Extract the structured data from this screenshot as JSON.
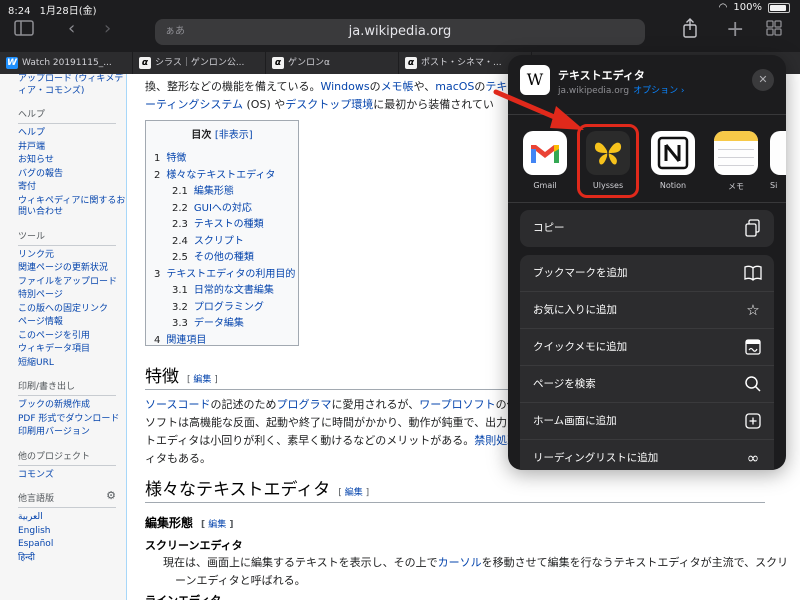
{
  "status": {
    "time": "8:24",
    "date": "1月28日(金)",
    "battery": "100%"
  },
  "toolbar": {
    "url": "ja.wikipedia.org",
    "url_prefix": "ぁあ"
  },
  "tabs": [
    {
      "label": "Watch 20191115_...",
      "icon": "W"
    },
    {
      "label": "シラス｜ゲンロン公...",
      "icon": "α"
    },
    {
      "label": "ゲンロンα",
      "icon": "α"
    },
    {
      "label": "ポスト・シネマ・...",
      "icon": "α"
    }
  ],
  "sidebar": {
    "top_item": "アップロード (ウィキメディア・コモンズ)",
    "sections": [
      {
        "heading": "ヘルプ",
        "items": [
          "ヘルプ",
          "井戸端",
          "お知らせ",
          "バグの報告",
          "寄付",
          "ウィキペディアに関するお問い合わせ"
        ]
      },
      {
        "heading": "ツール",
        "items": [
          "リンク元",
          "関連ページの更新状況",
          "ファイルをアップロード",
          "特別ページ",
          "この版への固定リンク",
          "ページ情報",
          "このページを引用",
          "ウィキデータ項目",
          "短縮URL"
        ]
      },
      {
        "heading": "印刷/書き出し",
        "items": [
          "ブックの新規作成",
          "PDF 形式でダウンロード",
          "印刷用バージョン"
        ]
      },
      {
        "heading": "他のプロジェクト",
        "items": [
          "コモンズ"
        ]
      },
      {
        "heading": "他言語版",
        "items": [
          "العربية",
          "English",
          "Español",
          "हिन्दी"
        ]
      }
    ]
  },
  "article": {
    "intro_line1_a": "換、整形などの機能を備えている。",
    "intro_line1_link1": "Windows",
    "intro_line1_b": "の",
    "intro_line1_link2": "メモ帳",
    "intro_line1_c": "や、",
    "intro_line1_link3": "macOS",
    "intro_line1_d": "の",
    "intro_line1_link4": "テキス",
    "intro_line2_link1": "ーティングシステム",
    "intro_line2_a": " (OS) や",
    "intro_line2_link2": "デスクトップ環境",
    "intro_line2_b": "に最初から装備されてい",
    "toc": {
      "title": "目次",
      "hide": "[非表示]",
      "entries": [
        {
          "n": "1",
          "label": "特徴",
          "sub": false
        },
        {
          "n": "2",
          "label": "様々なテキストエディタ",
          "sub": false
        },
        {
          "n": "2.1",
          "label": "編集形態",
          "sub": true
        },
        {
          "n": "2.2",
          "label": "GUIへの対応",
          "sub": true
        },
        {
          "n": "2.3",
          "label": "テキストの種類",
          "sub": true
        },
        {
          "n": "2.4",
          "label": "スクリプト",
          "sub": true
        },
        {
          "n": "2.5",
          "label": "その他の種類",
          "sub": true
        },
        {
          "n": "3",
          "label": "テキストエディタの利用目的",
          "sub": false
        },
        {
          "n": "3.1",
          "label": "日常的な文書編集",
          "sub": true
        },
        {
          "n": "3.2",
          "label": "プログラミング",
          "sub": true
        },
        {
          "n": "3.3",
          "label": "データ編集",
          "sub": true
        },
        {
          "n": "4",
          "label": "関連項目",
          "sub": false
        }
      ]
    },
    "h_features": "特徴",
    "edit_label": "編集",
    "features_l1_link1": "ソースコード",
    "features_l1_a": "の記述のため",
    "features_l1_link2": "プログラマ",
    "features_l1_b": "に愛用されるが、",
    "features_l1_link3": "ワープロソフト",
    "features_l1_c": "の代",
    "features_l2": "ソフトは高機能な反面、起動や終了に時間がかかり、動作が鈍重で、出力さ",
    "features_l3_a": "トエディタは小回りが利く、素早く動けるなどのメリットがある。",
    "features_l3_link": "禁則処理",
    "features_l4": "ィタもある。",
    "h_various": "様々なテキストエディタ",
    "h_edit_form": "編集形態",
    "h_screen_editor": "スクリーンエディタ",
    "screen_l1_a": "現在は、画面上に編集するテキストを表示し、その上で",
    "screen_l1_link": "カーソル",
    "screen_l1_b": "を移動させて編集を行なうテキストエディタが主流で、スクリ",
    "screen_l2": "ーンエディタと呼ばれる。",
    "h_line_editor": "ラインエディタ"
  },
  "share": {
    "title": "テキストエディタ",
    "domain": "ja.wikipedia.org",
    "options": "オプション ›",
    "close": "✕",
    "apps": [
      {
        "label": "Gmail"
      },
      {
        "label": "Ulysses"
      },
      {
        "label": "Notion"
      },
      {
        "label": "メモ"
      },
      {
        "label": "Si"
      }
    ],
    "copy": "コピー",
    "actions": [
      {
        "label": "ブックマークを追加",
        "icon": "book-icon"
      },
      {
        "label": "お気に入りに追加",
        "icon": "star-icon"
      },
      {
        "label": "クイックメモに追加",
        "icon": "quick-note-icon"
      },
      {
        "label": "ページを検索",
        "icon": "search-icon"
      },
      {
        "label": "ホーム画面に追加",
        "icon": "add-square-icon"
      },
      {
        "label": "リーディングリストに追加",
        "icon": "glasses-icon"
      }
    ]
  },
  "colors": {
    "highlight": "#e0291b",
    "link": "#0645ad",
    "sheet_bg": "#1c1c1e",
    "ios_blue": "#0a84ff"
  }
}
